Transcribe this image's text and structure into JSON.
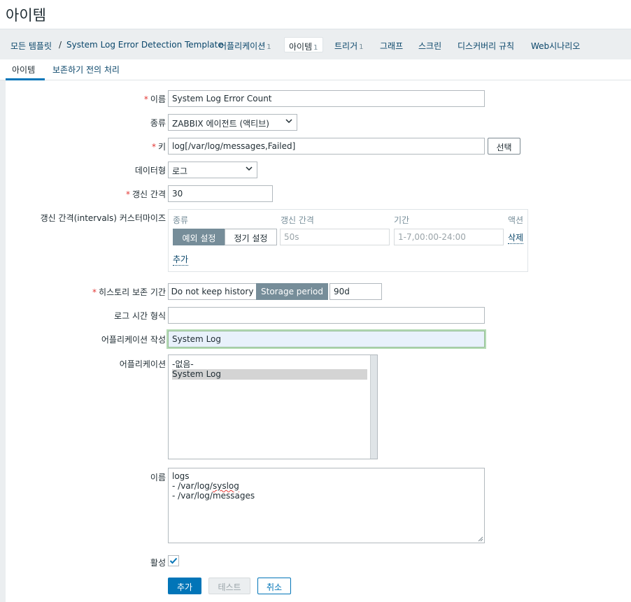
{
  "page": {
    "title": "아이템"
  },
  "breadcrumbs": {
    "all_templates": "모든 템플릿",
    "separator": "/",
    "template": "System Log Error Detection Template",
    "applications": {
      "label": "어플리케이션",
      "count": "1"
    },
    "items": {
      "label": "아이템",
      "count": "1"
    },
    "triggers": {
      "label": "트리거",
      "count": "1"
    },
    "graphs": "그래프",
    "screens": "스크린",
    "discovery": "디스커버리 규칙",
    "web": "Web시나리오"
  },
  "tabs": {
    "item": "아이템",
    "preprocessing": "보존하기 전의 처리"
  },
  "form": {
    "name": {
      "label": "이름",
      "value": "System Log Error Count"
    },
    "type": {
      "label": "종류",
      "value": "ZABBIX 에이전트 (액티브)"
    },
    "key": {
      "label": "키",
      "value": "log[/var/log/messages,Failed]",
      "select_button": "선택"
    },
    "data_type": {
      "label": "데이터형",
      "value": "로그"
    },
    "update_interval": {
      "label": "갱신 간격",
      "value": "30"
    },
    "custom_intervals": {
      "label": "갱신 간격(intervals) 커스터마이즈",
      "headers": {
        "type": "종류",
        "interval": "갱신 간격",
        "period": "기간",
        "action": "액션"
      },
      "type_flexible": "예외 설정",
      "type_scheduling": "정기 설정",
      "interval_placeholder": "50s",
      "period_placeholder": "1-7,00:00-24:00",
      "remove": "삭제",
      "add": "추가"
    },
    "history": {
      "label": "히스토리 보존 기간",
      "do_not_keep": "Do not keep history",
      "storage_period": "Storage period",
      "value": "90d"
    },
    "log_time_format": {
      "label": "로그 시간 형식",
      "value": ""
    },
    "new_application": {
      "label": "어플리케이션 작성",
      "value": "System Log"
    },
    "applications": {
      "label": "어플리케이션",
      "options": [
        "-없음-",
        "System Log"
      ],
      "selected": "System Log"
    },
    "description": {
      "label": "이름",
      "lines": [
        "logs",
        "- /var/log/",
        "syslog",
        "- /var/log/messages"
      ]
    },
    "enabled": {
      "label": "활성",
      "checked": true
    }
  },
  "buttons": {
    "add": "추가",
    "test": "테스트",
    "cancel": "취소"
  },
  "colors": {
    "accent": "#0275b8",
    "required": "#e33734",
    "link": "#0a466a"
  }
}
